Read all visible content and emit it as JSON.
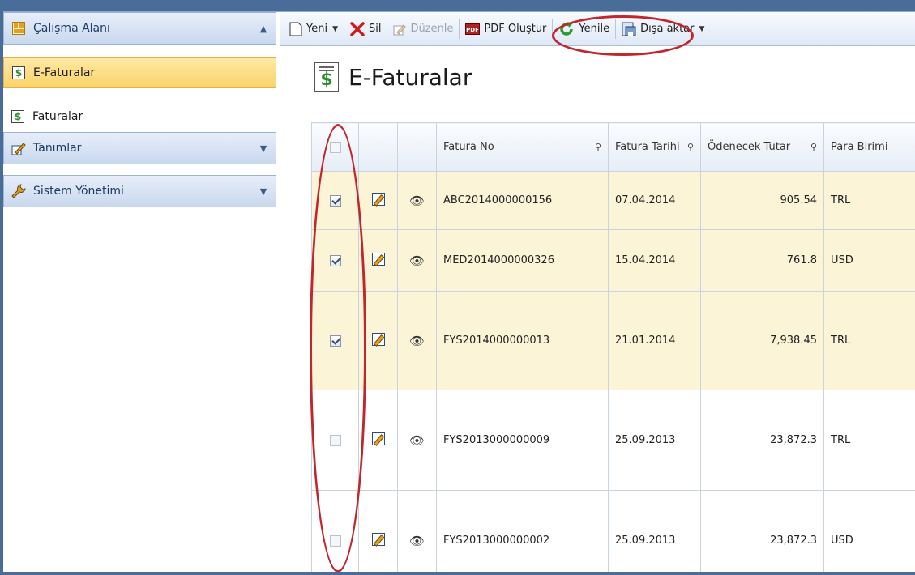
{
  "sidebar": {
    "groups": [
      {
        "label": "Çalışma Alanı",
        "icon": "workspace-icon",
        "expanded": true
      },
      {
        "label": "Tanımlar",
        "icon": "pencil-icon",
        "expanded": false
      },
      {
        "label": "Sistem Yönetimi",
        "icon": "wrench-icon",
        "expanded": false
      }
    ],
    "items": [
      {
        "label": "E-Faturalar",
        "icon": "invoice-dollar-icon",
        "active": true
      },
      {
        "label": "Faturalar",
        "icon": "invoice-dollar-icon",
        "active": false
      }
    ]
  },
  "toolbar": {
    "new_label": "Yeni",
    "delete_label": "Sil",
    "edit_label": "Düzenle",
    "pdf_label": "PDF Oluştur",
    "refresh_label": "Yenile",
    "export_label": "Dışa aktar"
  },
  "page": {
    "title": "E-Faturalar"
  },
  "grid": {
    "columns": [
      "Fatura No",
      "Fatura Tarihi",
      "Ödenecek Tutar",
      "Para Birimi"
    ],
    "rows": [
      {
        "checked": true,
        "no": "ABC2014000000156",
        "date": "07.04.2014",
        "amount": "905.54",
        "currency": "TRL"
      },
      {
        "checked": true,
        "no": "MED2014000000326",
        "date": "15.04.2014",
        "amount": "761.8",
        "currency": "USD"
      },
      {
        "checked": true,
        "no": "FYS2014000000013",
        "date": "21.01.2014",
        "amount": "7,938.45",
        "currency": "TRL"
      },
      {
        "checked": false,
        "no": "FYS2013000000009",
        "date": "25.09.2013",
        "amount": "23,872.3",
        "currency": "TRL"
      },
      {
        "checked": false,
        "no": "FYS2013000000002",
        "date": "25.09.2013",
        "amount": "23,872.3",
        "currency": "USD"
      }
    ]
  },
  "colors": {
    "accent_red": "#c0262b",
    "selected_row": "#fbf4d6",
    "active_nav": "#fbd36a"
  }
}
